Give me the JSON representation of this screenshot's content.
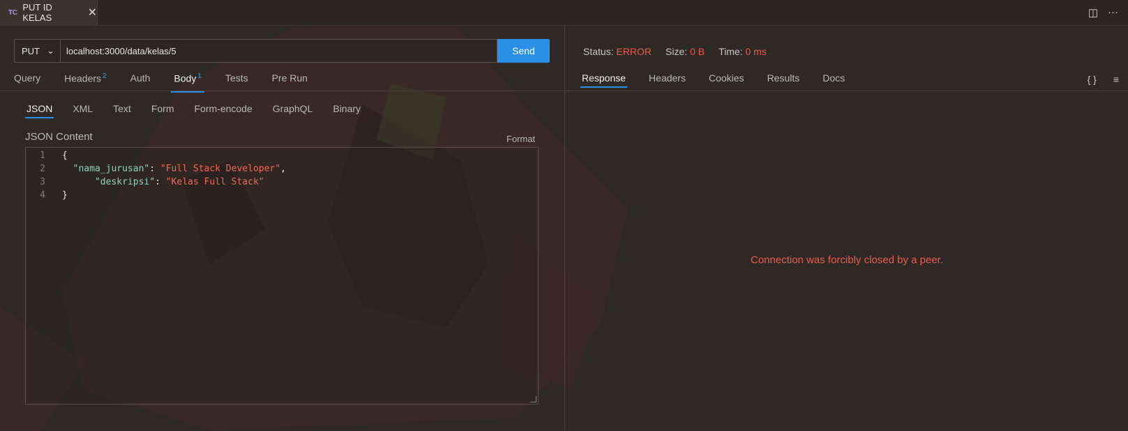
{
  "tab": {
    "logo": "TC",
    "title": "PUT ID KELAS",
    "close": "✕"
  },
  "window_icons": {
    "split": "◫",
    "more": "···"
  },
  "request": {
    "method": "PUT",
    "method_chevron": "⌄",
    "url": "localhost:3000/data/kelas/5",
    "send_label": "Send"
  },
  "request_tabs": [
    {
      "label": "Query",
      "badge": ""
    },
    {
      "label": "Headers",
      "badge": "2"
    },
    {
      "label": "Auth",
      "badge": ""
    },
    {
      "label": "Body",
      "badge": "1"
    },
    {
      "label": "Tests",
      "badge": ""
    },
    {
      "label": "Pre Run",
      "badge": ""
    }
  ],
  "active_request_tab": "Body",
  "body_tabs": [
    "JSON",
    "XML",
    "Text",
    "Form",
    "Form-encode",
    "GraphQL",
    "Binary"
  ],
  "active_body_tab": "JSON",
  "json_content_label": "JSON Content",
  "format_label": "Format",
  "editor_lines": [
    {
      "num": "1",
      "indent": "",
      "key": "",
      "sep": "",
      "value": "",
      "plain": "{"
    },
    {
      "num": "2",
      "indent": "  ",
      "key": "\"nama_jurusan\"",
      "sep": ": ",
      "value": "\"Full Stack Developer\"",
      "plain": ","
    },
    {
      "num": "3",
      "indent": "      ",
      "key": "\"deskripsi\"",
      "sep": ": ",
      "value": "\"Kelas Full Stack\"",
      "plain": ""
    },
    {
      "num": "4",
      "indent": "",
      "key": "",
      "sep": "",
      "value": "",
      "plain": "}"
    }
  ],
  "response_status": {
    "status_label": "Status:",
    "status_value": "ERROR",
    "size_label": "Size:",
    "size_value": "0 B",
    "time_label": "Time:",
    "time_value": "0 ms"
  },
  "response_tabs": [
    "Response",
    "Headers",
    "Cookies",
    "Results",
    "Docs"
  ],
  "active_response_tab": "Response",
  "response_icons": {
    "braces": "{ }",
    "menu": "≡"
  },
  "response_message": "Connection was forcibly closed by a peer.",
  "colors": {
    "accent": "#2b8ee8",
    "error": "#ef5a4a",
    "json_key": "#8fd1c1",
    "json_string": "#ef6a5a"
  }
}
